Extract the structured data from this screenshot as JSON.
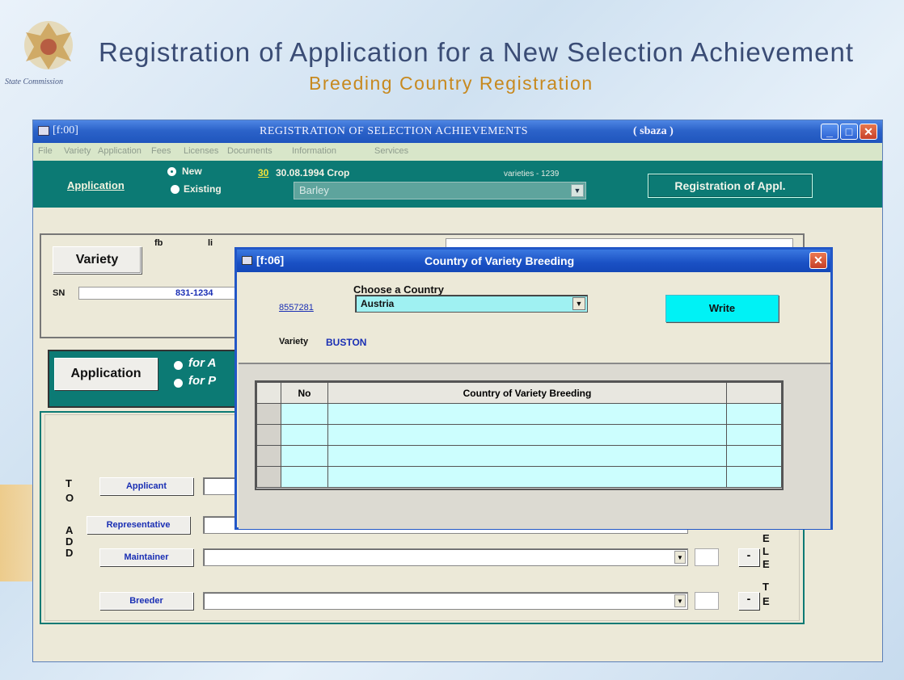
{
  "slide": {
    "title": "Registration of Application for a New Selection Achievement",
    "subtitle": "Breeding Country Registration",
    "crest_caption": "State Commission"
  },
  "window": {
    "code": "[f:00]",
    "title": "REGISTRATION OF SELECTION ACHIEVEMENTS",
    "user": "( sbaza )"
  },
  "menu": [
    "File",
    "Variety",
    "Application",
    "Fees",
    "Licenses",
    "Documents",
    "Information",
    "Services"
  ],
  "toolbar": {
    "application_label": "Application",
    "radio_new": "New",
    "radio_existing": "Existing",
    "number_link": "30",
    "crop_text": "30.08.1994 Crop",
    "varieties": "varieties - 1239",
    "crop_value": "Barley",
    "registration_button": "Registration of Appl."
  },
  "variety_panel": {
    "button": "Variety",
    "lbl_a": "fb",
    "lbl_b": "li",
    "sn_label": "SN",
    "sn_value": "831-1234"
  },
  "application_panel": {
    "button": "Application",
    "option_a": "for A",
    "option_b": "for P"
  },
  "roles": {
    "to_add": [
      "T",
      "O",
      "A",
      "D",
      "D"
    ],
    "delete": [
      "E",
      "L",
      "E",
      "T",
      "E"
    ],
    "applicant": "Applicant",
    "representative": "Representative",
    "maintainer": "Maintainer",
    "breeder": "Breeder",
    "minus": "-"
  },
  "dialog": {
    "code": "[f:06]",
    "title": "Country of Variety Breeding",
    "choose_label": "Choose a Country",
    "code_link": "8557281",
    "country_value": "Austria",
    "write_button": "Write",
    "variety_label": "Variety",
    "variety_value": "BUSTON",
    "grid_headers": [
      "No",
      "Country of Variety Breeding"
    ]
  }
}
